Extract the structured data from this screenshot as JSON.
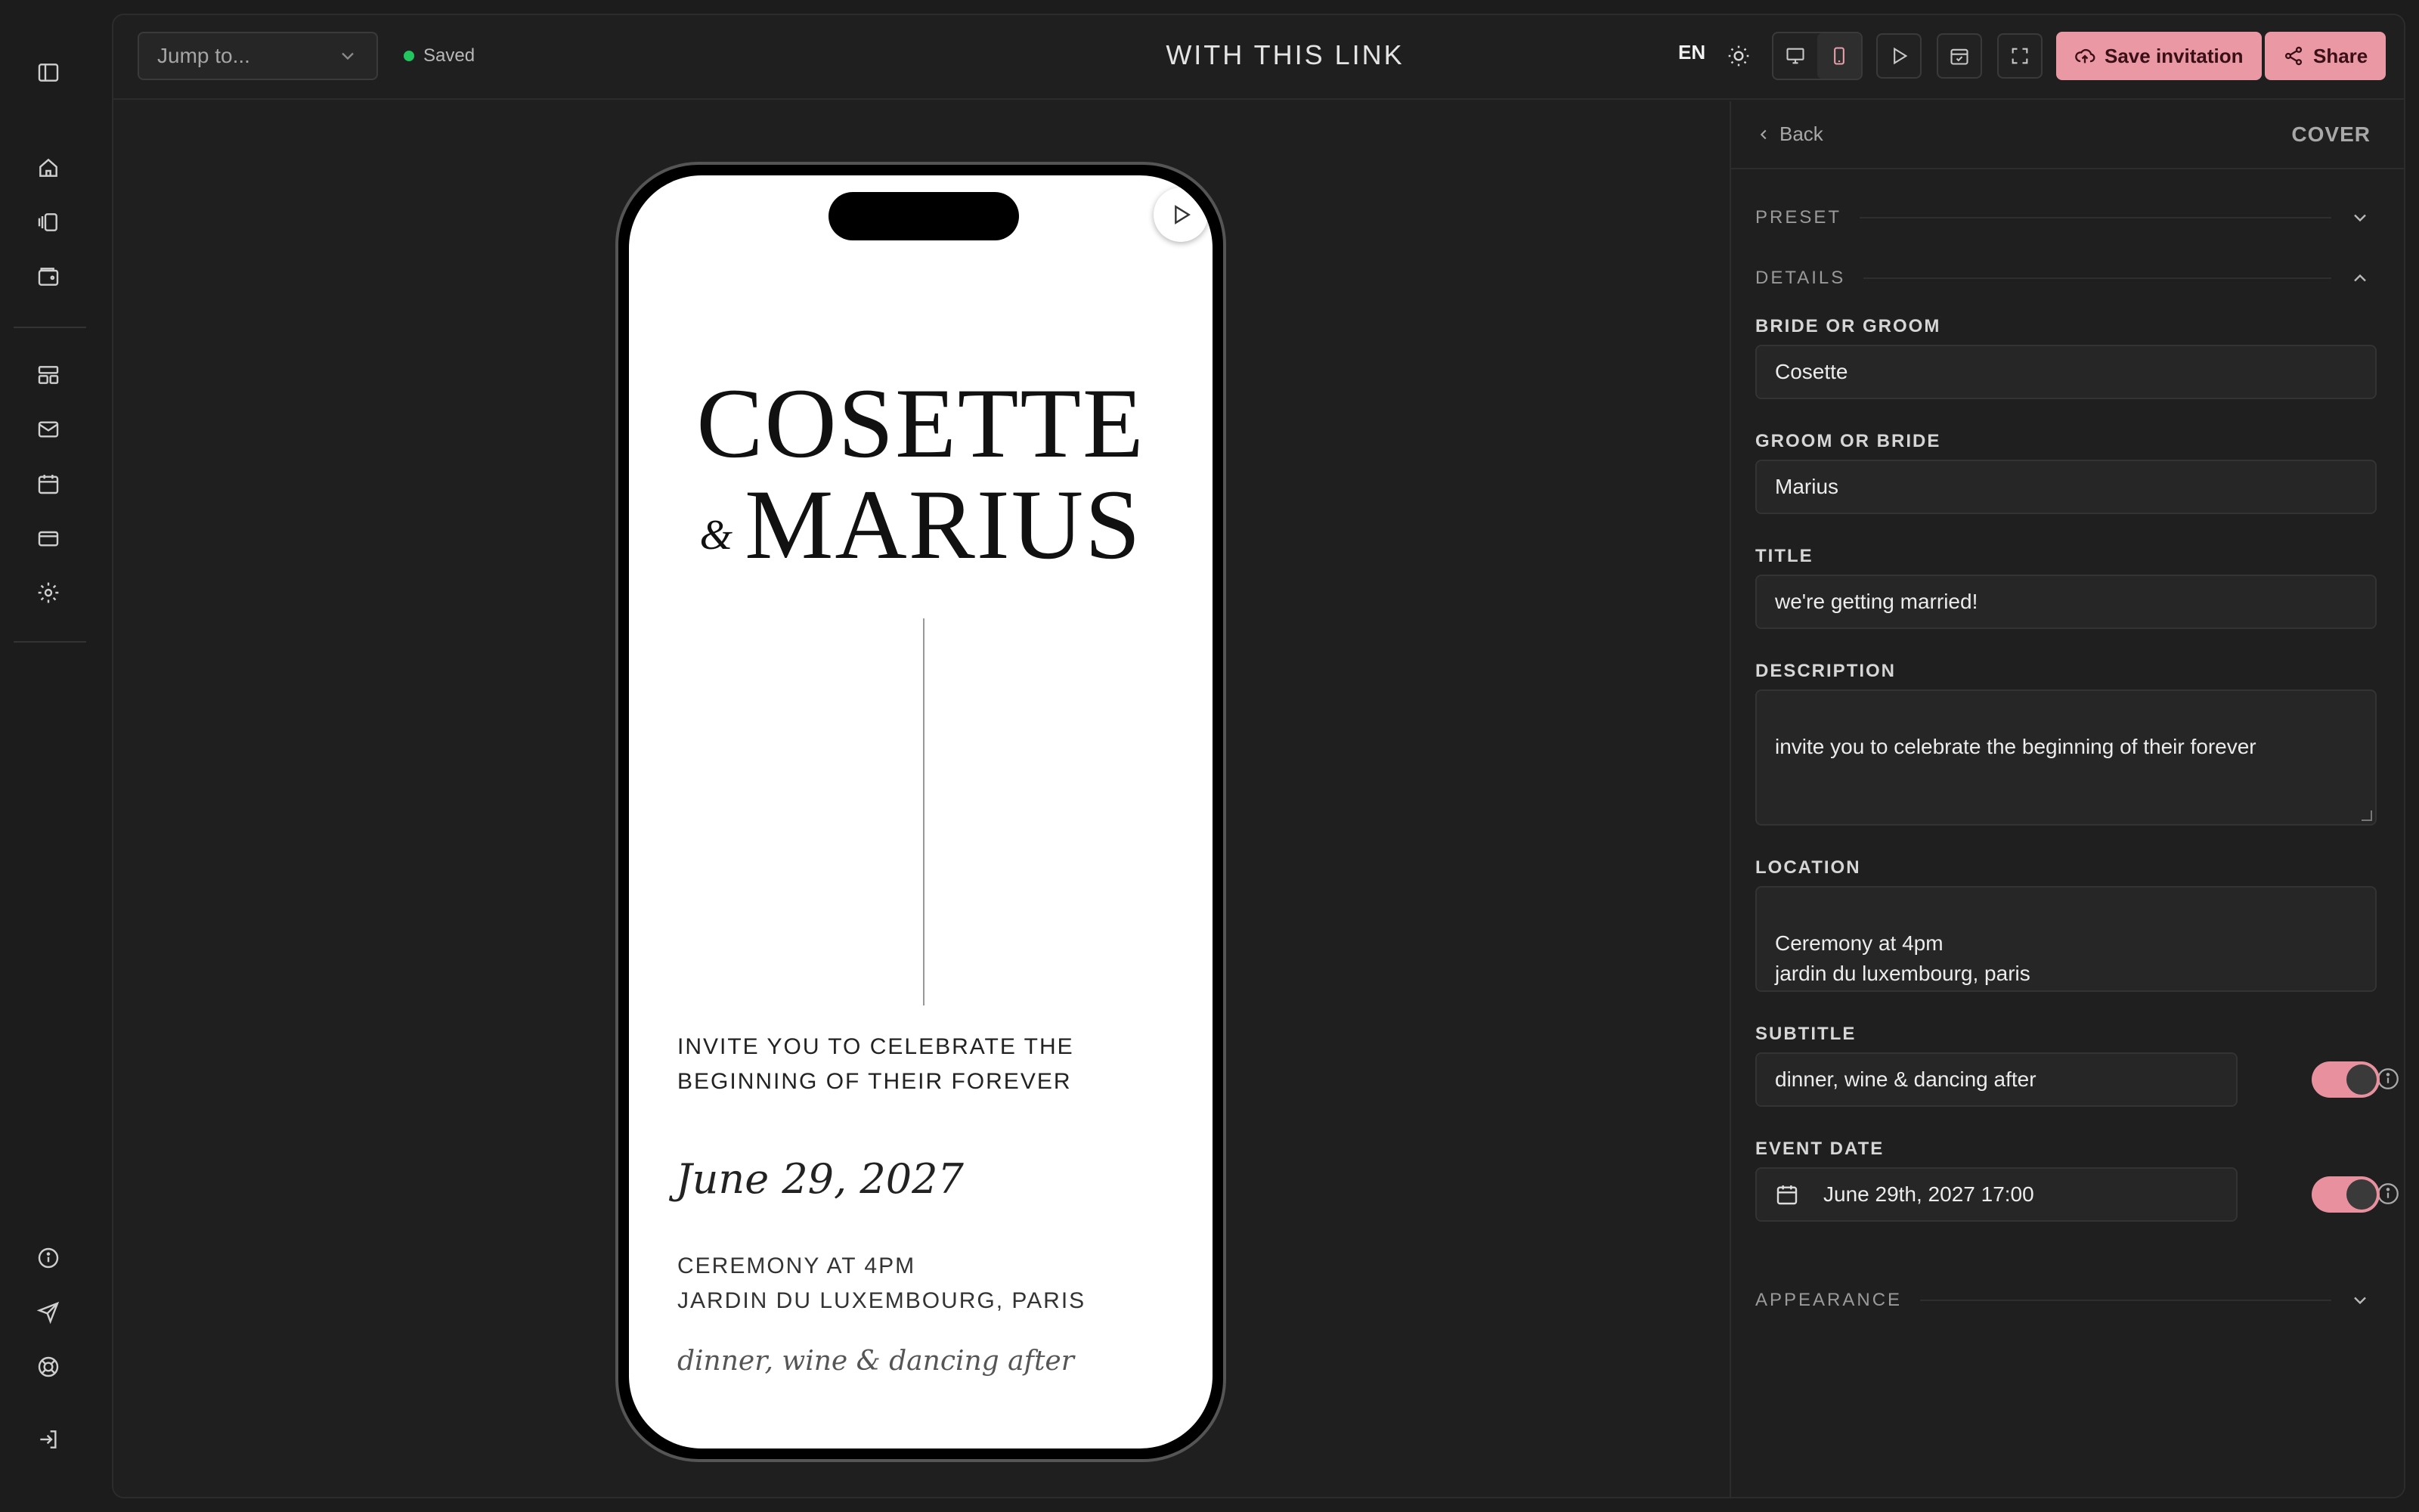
{
  "topbar": {
    "jump_placeholder": "Jump to...",
    "status": "Saved",
    "title": "WITH THIS LINK",
    "language": "EN",
    "save_label": "Save invitation",
    "share_label": "Share"
  },
  "preview": {
    "name1": "COSETTE",
    "amp": "&",
    "name2": "MARIUS",
    "description": "invite you to celebrate the beginning of their forever",
    "date": "June 29, 2027",
    "location": "CEREMONY AT 4PM\nJARDIN DU LUXEMBOURG, PARIS",
    "subtitle": "dinner, wine & dancing after"
  },
  "panel": {
    "back_label": "Back",
    "section_title": "COVER",
    "preset_label": "PRESET",
    "details_label": "DETAILS",
    "appearance_label": "APPEARANCE",
    "fields": {
      "bride_label": "BRIDE OR GROOM",
      "bride_value": "Cosette",
      "groom_label": "GROOM OR BRIDE",
      "groom_value": "Marius",
      "title_label": "TITLE",
      "title_value": "we're getting married!",
      "description_label": "DESCRIPTION",
      "description_value": "invite you to celebrate the beginning of their forever",
      "location_label": "LOCATION",
      "location_value": "Ceremony at 4pm\njardin du luxembourg, paris",
      "subtitle_label": "SUBTITLE",
      "subtitle_value": "dinner, wine & dancing after",
      "event_date_label": "EVENT DATE",
      "event_date_value": "June 29th, 2027 17:00"
    },
    "subtitle_toggle_on": true,
    "event_date_toggle_on": true
  },
  "colors": {
    "accent": "#ea98a4",
    "status_green": "#22c55e",
    "background": "#1c1c1c"
  }
}
